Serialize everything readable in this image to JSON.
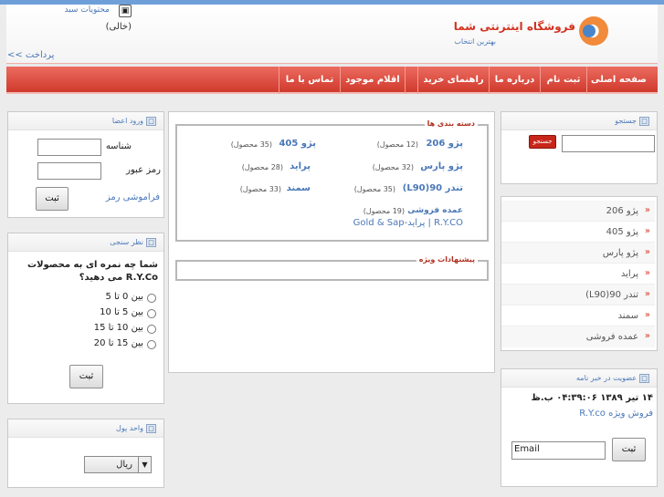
{
  "header": {
    "shop_title": "فروشگاه اینترنتی شما",
    "shop_subtitle": "بهترین انتخاب",
    "cart_title": "محتویات سبد",
    "cart_status": "(خالی)",
    "checkout_link": "پرداخت >>"
  },
  "nav": {
    "items": [
      {
        "label": "صفحه اصلی"
      },
      {
        "label": "ثبت نام"
      },
      {
        "label": "درباره ما"
      },
      {
        "label": "راهنمای خرید"
      },
      {
        "label": "اقلام موجود"
      },
      {
        "label": "تماس با ما"
      }
    ]
  },
  "search": {
    "title": "جستجو",
    "button": "جستجو",
    "value": ""
  },
  "sidebar_categories": {
    "items": [
      {
        "label": "پژو 206"
      },
      {
        "label": "پژو 405"
      },
      {
        "label": "پژو پارس"
      },
      {
        "label": "پراید"
      },
      {
        "label": "تندر 90(L90)"
      },
      {
        "label": "سمند"
      },
      {
        "label": "عمده فروشی"
      }
    ]
  },
  "newsletter": {
    "title": "عضویت در خبر نامه",
    "date": "۱۴ تیر ۱۳۸۹ ۰۴:۳۹:۰۶ ب.ظ",
    "shop_line": "فروش ویژه R.Y.co",
    "email_value": "Email",
    "submit": "ثبت"
  },
  "categories": {
    "legend": "دسته بندی ها",
    "items": [
      {
        "name": "پژو 206",
        "count": "(12 محصول)"
      },
      {
        "name": "پژو 405",
        "count": "(35 محصول)"
      },
      {
        "name": "پژو پارس",
        "count": "(32 محصول)"
      },
      {
        "name": "پراید",
        "count": "(28 محصول)"
      },
      {
        "name": "تندر 90(L90)",
        "count": "(35 محصول)"
      },
      {
        "name": "سمند",
        "count": "(33 محصول)"
      },
      {
        "name": "عمده فروشی",
        "count": "(19 محصول)"
      }
    ],
    "sub_links": "Gold & Sap-پراید | R.Y.CO"
  },
  "specials": {
    "legend": "پیشنهادات ویژه"
  },
  "login": {
    "title": "ورود اعضا",
    "username_label": "شناسه",
    "password_label": "رمز عبور",
    "submit": "ثبت",
    "forgot": "فراموشی رمز"
  },
  "poll": {
    "title": "نظر سنجی",
    "question": "شما چه نمره ای به محصولات R.Y.Co می دهید؟",
    "options": [
      {
        "label": "بین 0 تا 5"
      },
      {
        "label": "بین 5 تا 10"
      },
      {
        "label": "بین 10 تا 15"
      },
      {
        "label": "بین 15 تا 20"
      }
    ],
    "submit": "ثبت"
  },
  "currency": {
    "title": "واحد پول",
    "selected": "ریال"
  }
}
